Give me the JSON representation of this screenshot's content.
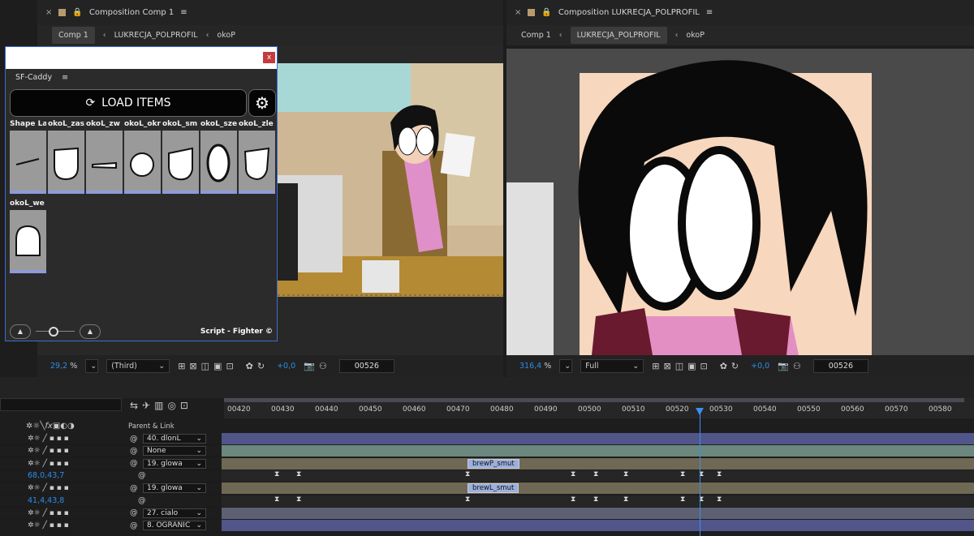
{
  "left_panel": {
    "title": "Composition Comp 1",
    "breadcrumbs": [
      "Comp 1",
      "LUKRECJA_POLPROFIL",
      "okoP"
    ],
    "zoom": "29,2",
    "zoom_unit": "%",
    "resolution": "(Third)",
    "exposure": "+0,0",
    "timecode": "00526"
  },
  "right_panel": {
    "title": "Composition LUKRECJA_POLPROFIL",
    "breadcrumbs": [
      "Comp 1",
      "LUKRECJA_POLPROFIL",
      "okoP"
    ],
    "zoom": "316,4",
    "zoom_unit": "%",
    "resolution": "Full",
    "exposure": "+0,0",
    "timecode": "00526"
  },
  "caddy": {
    "title": "SF-Caddy",
    "load_label": "LOAD ITEMS",
    "close": "x",
    "footer": "Script - Fighter ©",
    "items": [
      {
        "label": "Shape La",
        "shape": "line"
      },
      {
        "label": "okoL_zas",
        "shape": "cup"
      },
      {
        "label": "okoL_zw",
        "shape": "wedge"
      },
      {
        "label": "okoL_okr",
        "shape": "circle"
      },
      {
        "label": "okoL_sm",
        "shape": "sad"
      },
      {
        "label": "okoL_sze",
        "shape": "oval"
      },
      {
        "label": "okoL_zle",
        "shape": "angry"
      },
      {
        "label": "okoL_we",
        "shape": "dome"
      }
    ]
  },
  "timeline": {
    "parent_header": "Parent & Link",
    "switch_icons": "fx",
    "ruler": [
      "00420",
      "00430",
      "00440",
      "00450",
      "00460",
      "00470",
      "00480",
      "00490",
      "00500",
      "00510",
      "00520",
      "00530",
      "00540",
      "00550",
      "00560",
      "00570",
      "00580"
    ],
    "layers": [
      {
        "parent": "40. dlonL",
        "value": ""
      },
      {
        "parent": "None",
        "value": ""
      },
      {
        "parent": "19. glowa",
        "value": ""
      },
      {
        "parent": "",
        "value": "68,0,43,7"
      },
      {
        "parent": "19. glowa",
        "value": ""
      },
      {
        "parent": "",
        "value": "41,4,43,8"
      },
      {
        "parent": "27. cialo",
        "value": ""
      },
      {
        "parent": "8. OGRANIC",
        "value": ""
      }
    ],
    "markers": [
      "brewP_smut",
      "brewL_smut"
    ]
  }
}
